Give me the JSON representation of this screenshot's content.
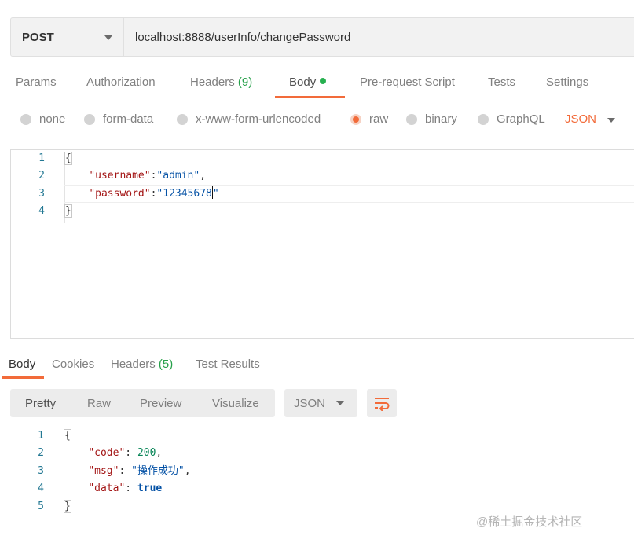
{
  "request": {
    "method": "POST",
    "url": "localhost:8888/userInfo/changePassword"
  },
  "request_tabs": {
    "params": "Params",
    "authorization": "Authorization",
    "headers": "Headers",
    "headers_count": "(9)",
    "body": "Body",
    "pre_request": "Pre-request Script",
    "tests": "Tests",
    "settings": "Settings"
  },
  "body_types": {
    "none": "none",
    "form_data": "form-data",
    "urlencoded": "x-www-form-urlencoded",
    "raw": "raw",
    "binary": "binary",
    "graphql": "GraphQL",
    "selected": "raw",
    "format": "JSON"
  },
  "request_body": {
    "line_numbers": [
      "1",
      "2",
      "3",
      "4"
    ],
    "open_brace": "{",
    "username_key": "\"username\"",
    "username_value": "\"admin\"",
    "password_key": "\"password\"",
    "password_value": "\"12345678",
    "password_value_end": "\"",
    "close_brace": "}"
  },
  "response_tabs": {
    "body": "Body",
    "cookies": "Cookies",
    "headers": "Headers",
    "headers_count": "(5)",
    "test_results": "Test Results"
  },
  "response_toolbar": {
    "pretty": "Pretty",
    "raw": "Raw",
    "preview": "Preview",
    "visualize": "Visualize",
    "format": "JSON"
  },
  "response_body": {
    "line_numbers": [
      "1",
      "2",
      "3",
      "4",
      "5"
    ],
    "open_brace": "{",
    "code_key": "\"code\"",
    "code_value": "200",
    "msg_key": "\"msg\"",
    "msg_value": "\"操作成功\"",
    "data_key": "\"data\"",
    "data_value": "true",
    "close_brace": "}"
  },
  "watermark": "@稀土掘金技术社区",
  "colors": {
    "accent": "#f26b3a",
    "count_green": "#26a04a",
    "status_dot": "#26b04f"
  }
}
